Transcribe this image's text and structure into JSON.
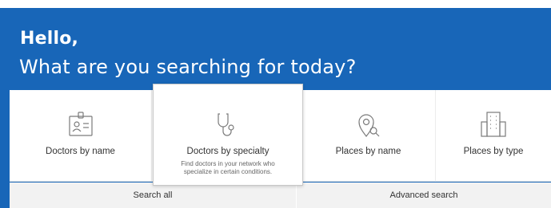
{
  "header": {
    "greeting": "Hello,",
    "question": "What are you searching for today?"
  },
  "cards": {
    "doctors_by_name": {
      "label": "Doctors by name",
      "icon": "id-badge-icon"
    },
    "doctors_by_specialty": {
      "label": "Doctors by specialty",
      "description": "Find doctors in your network who specialize in certain conditions.",
      "icon": "stethoscope-icon"
    },
    "places_by_name": {
      "label": "Places by name",
      "icon": "location-search-icon"
    },
    "places_by_type": {
      "label": "Places by type",
      "icon": "building-icon"
    }
  },
  "footer": {
    "search_all": "Search all",
    "advanced_search": "Advanced search"
  },
  "colors": {
    "brand_blue": "#1866b8",
    "icon_gray": "#7a7a7a"
  }
}
